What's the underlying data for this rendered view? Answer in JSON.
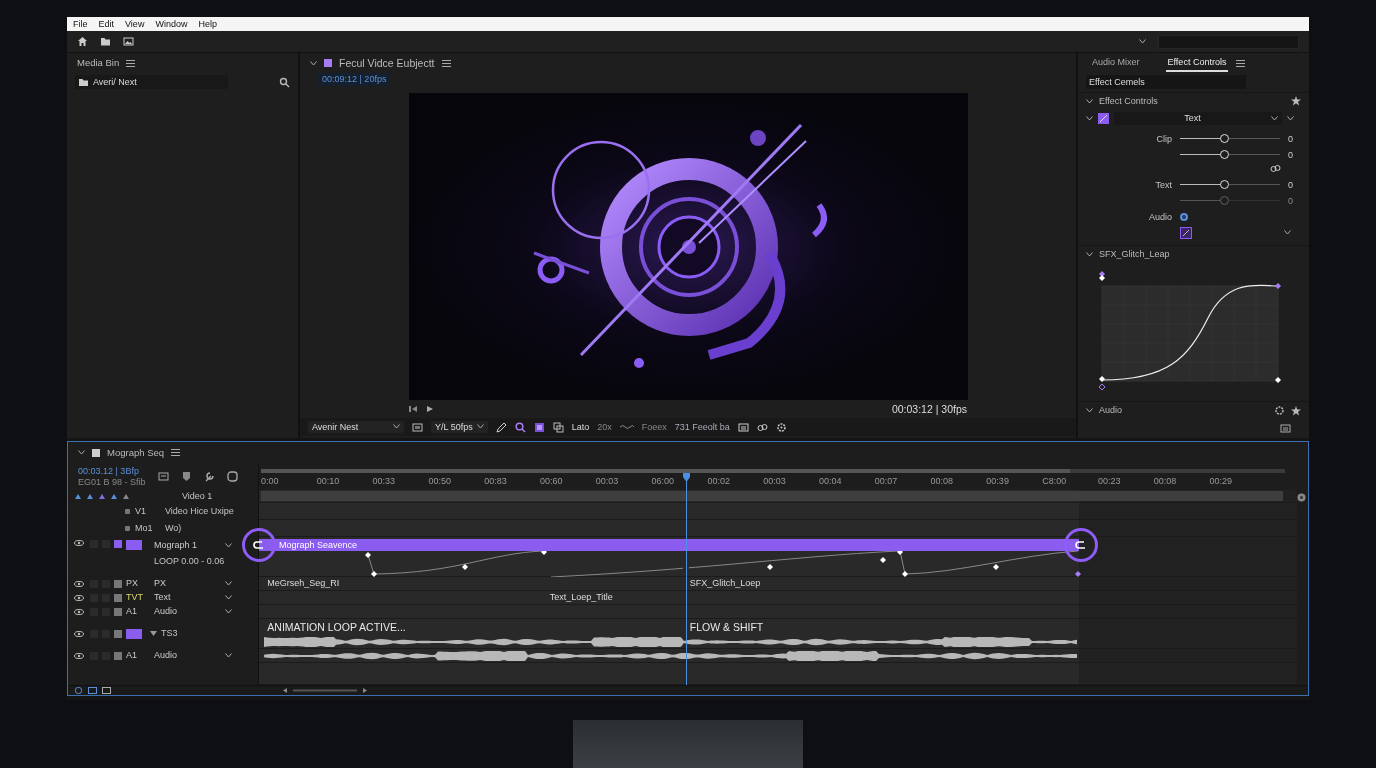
{
  "menu": [
    "File",
    "Edit",
    "View",
    "Window",
    "Help"
  ],
  "media_bin": {
    "title": "Media Bin",
    "folder": "Averi/ Next"
  },
  "program": {
    "title": "Fecul Vidce Eubjectt",
    "timecode": "00:09:12 | 20fps",
    "overlay_timecode": "00:03:12 | 30fps",
    "toolbar": {
      "font": "Avenir Nest",
      "scale_prefix": "Y/L",
      "fps": "50fps",
      "font2": "Lato",
      "size": "20x",
      "style": "Foeex",
      "preset": "731 Feeolt ba"
    }
  },
  "effect_panel": {
    "tabs": [
      {
        "label": "Audio Mixer",
        "selected": false
      },
      {
        "label": "Effect Controls",
        "selected": true
      }
    ],
    "field_value": "Effect Cemels",
    "section": "Effect Controls",
    "layer": "Text",
    "params": [
      {
        "label": "Clip",
        "level": 0.44,
        "reading": "0",
        "disabled": false
      },
      {
        "level": 0.44,
        "reading": "0",
        "disabled": false
      },
      {
        "label": "Text",
        "level": 0.44,
        "reading": "0",
        "disabled": false
      },
      {
        "level": 0.44,
        "reading": "0",
        "disabled": true
      }
    ],
    "audio_label": "Audio",
    "audio_checked": true,
    "curve_section": "SFX_Glitch_Leap",
    "audio_section": "Audio"
  },
  "timeline": {
    "title": "Mograph Seq",
    "timecode": "00:03.12 | 3Bfp",
    "subcode": "EG01 B 98 - Sfib",
    "ruler": [
      "0:00",
      "00:10",
      "00:33",
      "00:50",
      "00:83",
      "00:60",
      "00:03",
      "06:00",
      "00:02",
      "00:03",
      "00:04",
      "00:07",
      "00:08",
      "00:39",
      "C8:00",
      "00:23",
      "00:08",
      "00:29"
    ],
    "tracks": [
      {
        "kind": "group",
        "name": "Video 1"
      },
      {
        "kind": "plain",
        "code": "V1",
        "name": "Video Hice Uxipe"
      },
      {
        "kind": "plain",
        "code": "Mo1",
        "name": "Wo)"
      },
      {
        "kind": "clip",
        "visible": true,
        "name": "Mograph 1",
        "note": "LOOP 0.00 - 0.06",
        "clip": "Mograph Seavence"
      },
      {
        "kind": "layer",
        "visible": true,
        "code": "PX",
        "name": "PX",
        "labels": [
          "MeGrseh_Seg_RI",
          "SFX_Glitch_Loep"
        ]
      },
      {
        "kind": "layer",
        "visible": true,
        "code": "TVT",
        "name": "Text",
        "labels": [
          "Text_Loep_Title"
        ]
      },
      {
        "kind": "layer",
        "visible": true,
        "code": "A1",
        "name": "Audio"
      },
      {
        "kind": "title",
        "visible": true,
        "code": "TS3",
        "labels": [
          "ANIMATION LOOP ACTIVE...",
          "FLOW & SHIFT"
        ]
      },
      {
        "kind": "audio",
        "visible": true,
        "code": "A1",
        "name": "Audio"
      }
    ]
  }
}
